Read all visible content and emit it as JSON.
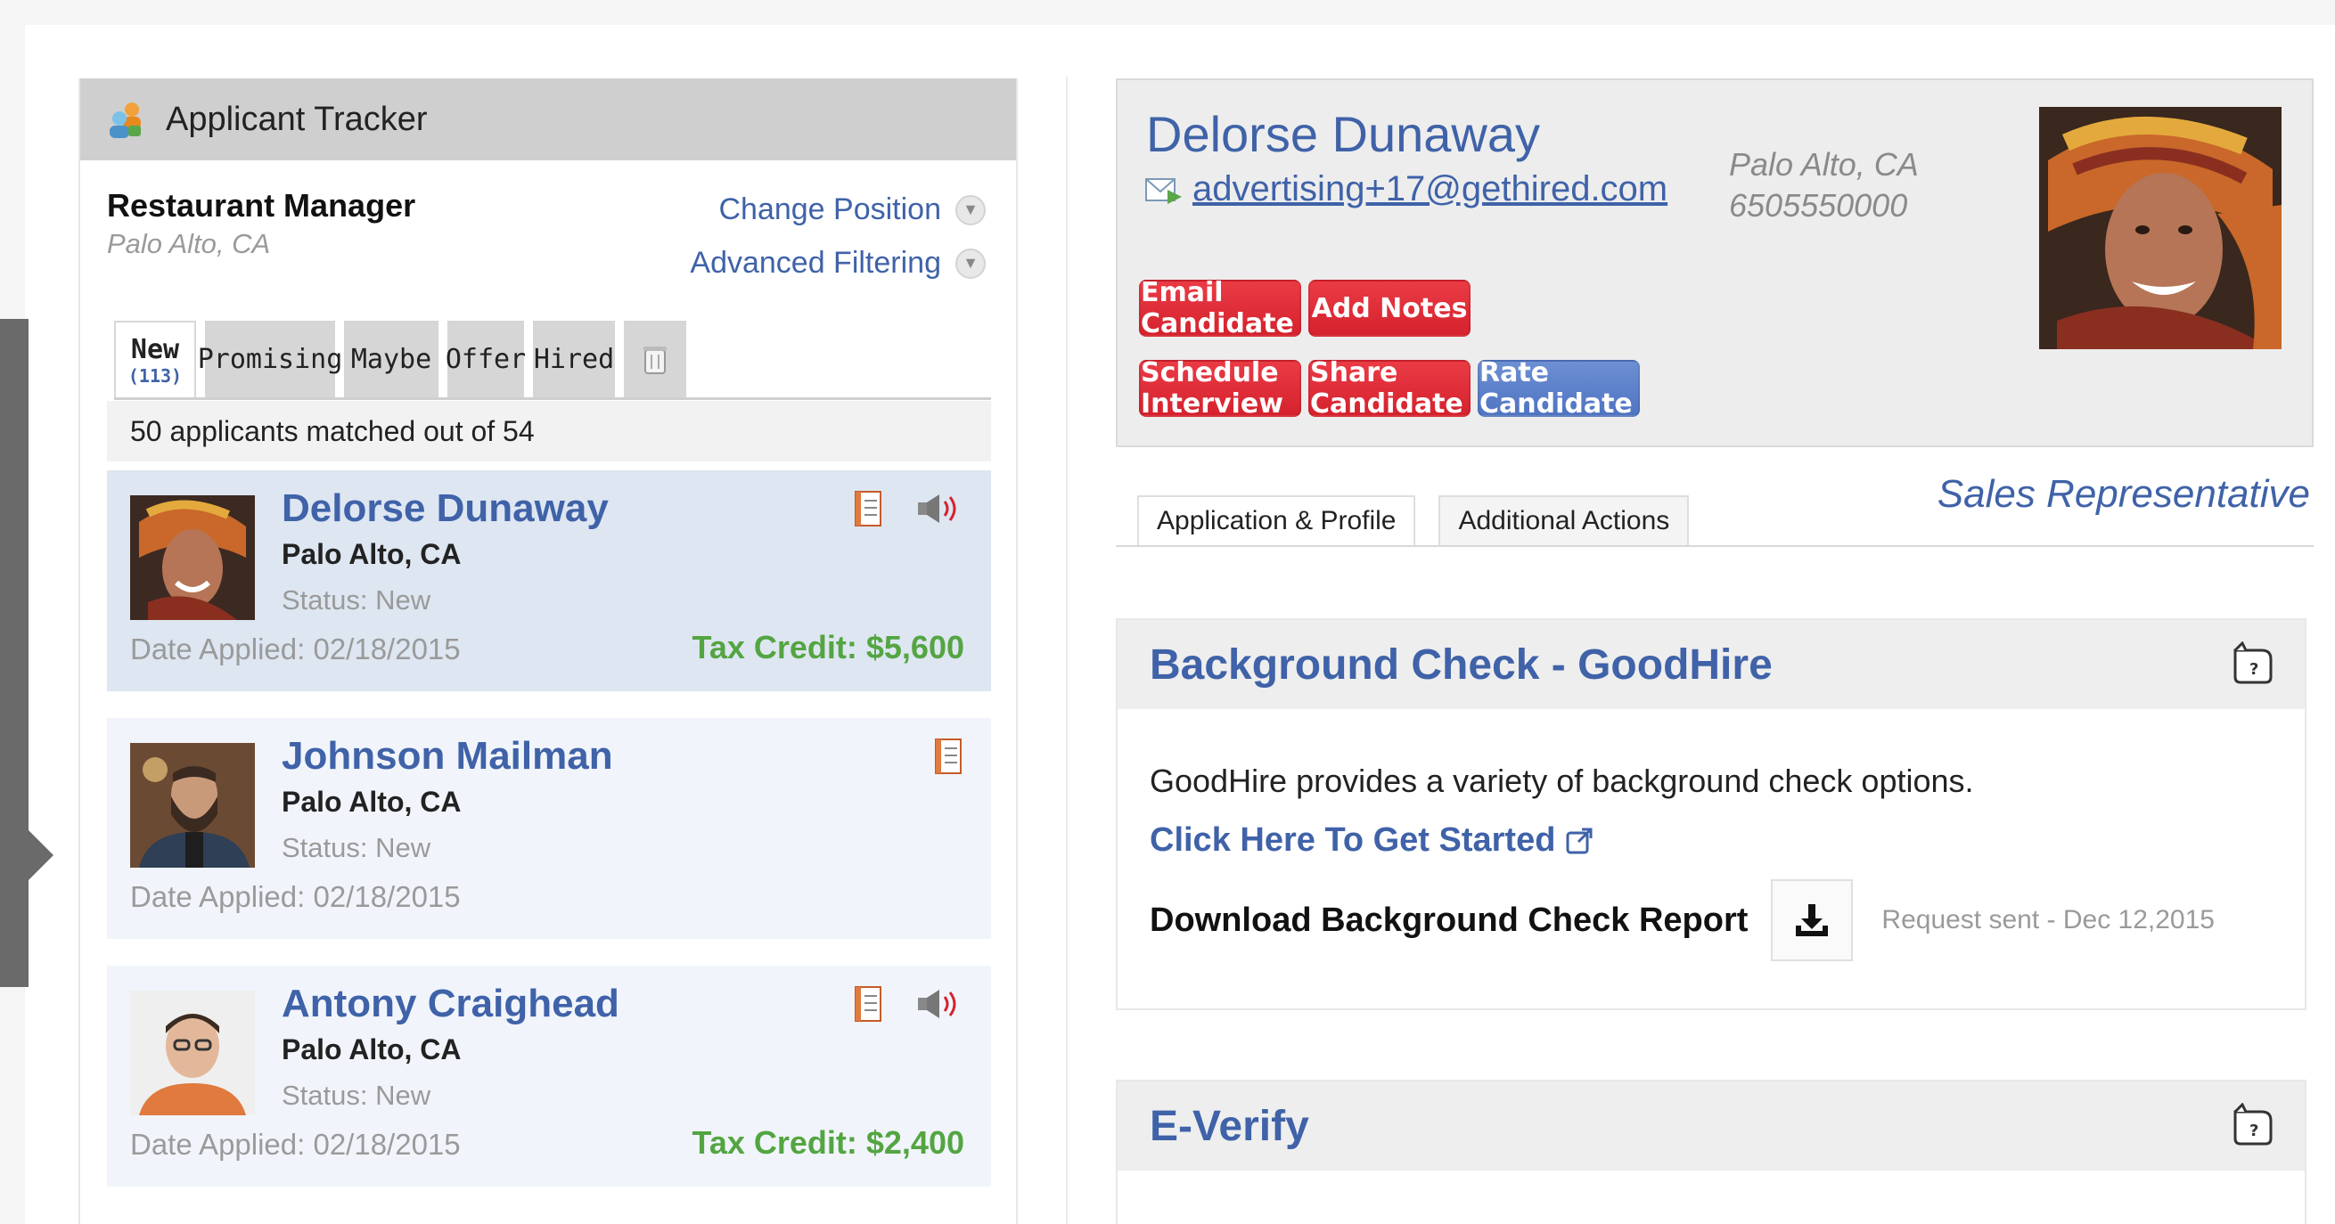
{
  "tracker": {
    "title": "Applicant Tracker",
    "position_title": "Restaurant Manager",
    "position_location": "Palo Alto, CA",
    "change_position": "Change Position",
    "advanced_filtering": "Advanced Filtering",
    "tabs": [
      {
        "label": "New",
        "count": "(113)",
        "active": true
      },
      {
        "label": "Promising"
      },
      {
        "label": "Maybe"
      },
      {
        "label": "Offer"
      },
      {
        "label": "Hired"
      }
    ],
    "match_text": "50 applicants matched out of 54",
    "applicants": [
      {
        "name": "Delorse Dunaway",
        "city": "Palo Alto, CA",
        "status": "Status: New",
        "date": "Date Applied: 02/18/2015",
        "tax_credit": "Tax Credit: $5,600"
      },
      {
        "name": "Johnson Mailman",
        "city": "Palo Alto, CA",
        "status": "Status: New",
        "date": "Date Applied: 02/18/2015",
        "tax_credit": ""
      },
      {
        "name": "Antony Craighead",
        "city": "Palo Alto, CA",
        "status": "Status: New",
        "date": "Date Applied: 02/18/2015",
        "tax_credit": "Tax Credit: $2,400"
      }
    ]
  },
  "profile": {
    "name": "Delorse Dunaway",
    "email": "advertising+17@gethired.com",
    "location": "Palo Alto, CA",
    "phone": "6505550000",
    "buttons": {
      "email": "Email Candidate",
      "notes": "Add Notes",
      "schedule": "Schedule Interview",
      "share": "Share Candidate",
      "rate": "Rate Candidate"
    },
    "tabs": [
      "Application & Profile",
      "Additional Actions"
    ],
    "position_label": "Sales Representative"
  },
  "background_check": {
    "title": "Background Check - GoodHire",
    "description": "GoodHire provides a variety of background check options.",
    "link": "Click Here To Get Started",
    "download_label": "Download Background Check Report",
    "request_status": "Request sent - Dec 12,2015"
  },
  "everify": {
    "title": "E-Verify"
  },
  "colors": {
    "accent_blue": "#3f62a8",
    "button_red": "#d5222e",
    "button_blue": "#4f74c2",
    "tax_green": "#54a542"
  }
}
